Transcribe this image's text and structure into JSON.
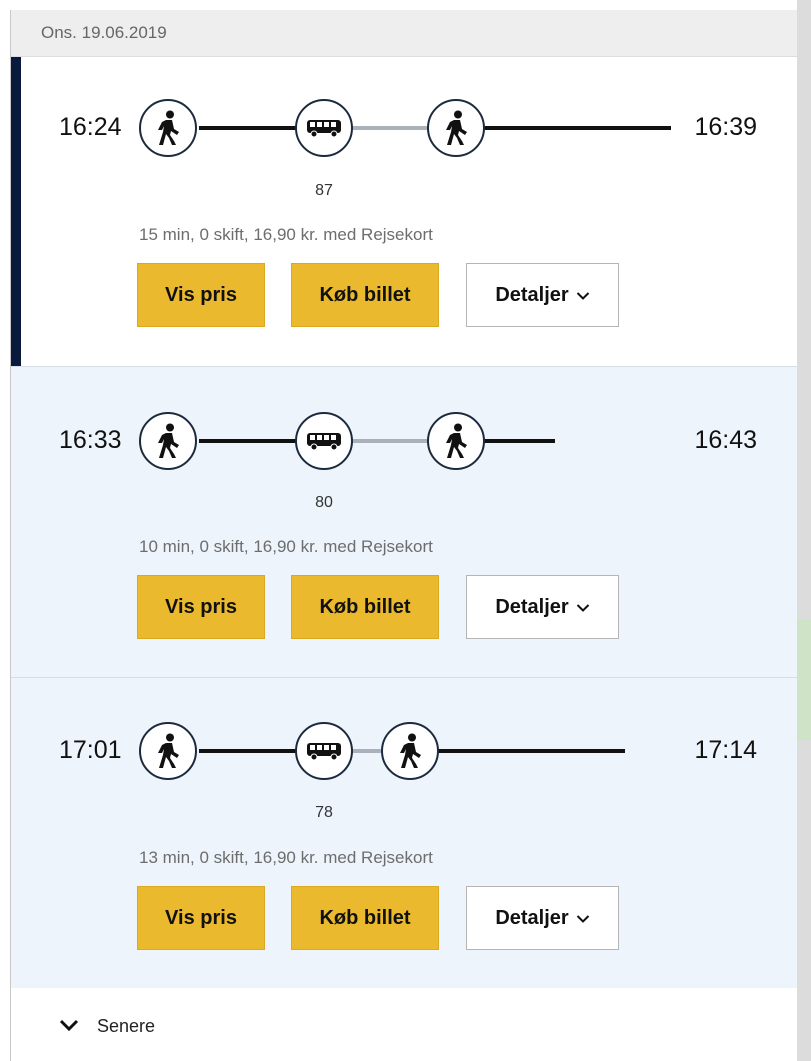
{
  "date_label": "Ons. 19.06.2019",
  "colors": {
    "accent_yellow": "#ebb92e",
    "selected_marker": "#0a1a3c",
    "alt_row_bg": "#eef4fc",
    "walk_line": "#111111",
    "bus_line": "#a9b1ba"
  },
  "icons": {
    "walk": "walking-person-icon",
    "bus": "bus-icon",
    "later": "chevron-down-icon",
    "details": "chevron-down-icon"
  },
  "trips": [
    {
      "departure": "16:24",
      "arrival": "16:39",
      "bus_number": "87",
      "summary": "15 min, 0 skift, 16,90 kr. med Rejsekort",
      "selected": true
    },
    {
      "departure": "16:33",
      "arrival": "16:43",
      "bus_number": "80",
      "summary": "10 min, 0 skift, 16,90 kr. med Rejsekort",
      "selected": false
    },
    {
      "departure": "17:01",
      "arrival": "17:14",
      "bus_number": "78",
      "summary": "13 min, 0 skift, 16,90 kr. med Rejsekort",
      "selected": false
    }
  ],
  "buttons": {
    "price": "Vis pris",
    "buy": "Køb billet",
    "details": "Detaljer"
  },
  "later_label": "Senere"
}
